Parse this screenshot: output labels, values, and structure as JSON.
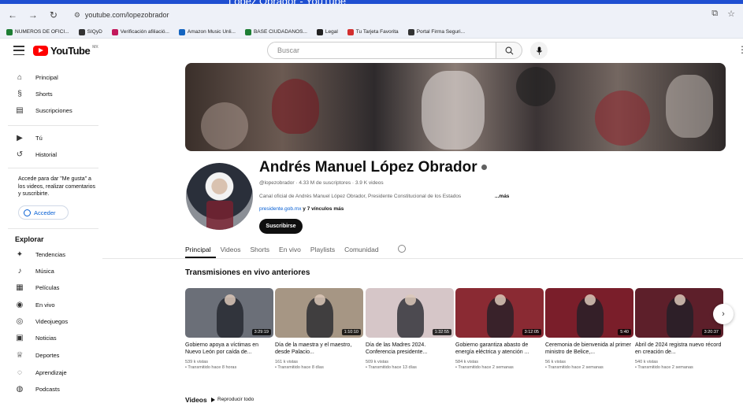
{
  "browser": {
    "tab_title": "López Obrador - YouTube",
    "url": "youtube.com/lopezobrador",
    "bookmarks": [
      {
        "label": "NUMEROS DE OFICI...",
        "color": "#1e7e34"
      },
      {
        "label": "SIQyD",
        "color": "#333333"
      },
      {
        "label": "Verificación afiliació...",
        "color": "#c2185b"
      },
      {
        "label": "Amazon Music Unli...",
        "color": "#1565c0"
      },
      {
        "label": "BASE CIUDADANOS...",
        "color": "#1e7e34"
      },
      {
        "label": "Legal",
        "color": "#222222"
      },
      {
        "label": "Tu Tarjeta Favorita",
        "color": "#d32f2f"
      },
      {
        "label": "Portal Firma Seguri...",
        "color": "#333333"
      }
    ]
  },
  "header": {
    "logo_text": "YouTube",
    "logo_country": "MX",
    "search_placeholder": "Buscar"
  },
  "sidebar": {
    "items_top": [
      {
        "label": "Principal",
        "icon": "home-icon",
        "glyph": "⌂"
      },
      {
        "label": "Shorts",
        "icon": "shorts-icon",
        "glyph": "§"
      },
      {
        "label": "Suscripciones",
        "icon": "subscriptions-icon",
        "glyph": "▤"
      }
    ],
    "items_you": [
      {
        "label": "Tú",
        "icon": "you-icon",
        "glyph": "▶"
      },
      {
        "label": "Historial",
        "icon": "history-icon",
        "glyph": "↺"
      }
    ],
    "signin_text": "Accede para dar \"Me gusta\" a los videos, realizar comentarios y suscribirte.",
    "signin_button": "Acceder",
    "explore_title": "Explorar",
    "explore_items": [
      {
        "label": "Tendencias",
        "icon": "trending-icon",
        "glyph": "✦"
      },
      {
        "label": "Música",
        "icon": "music-icon",
        "glyph": "♪"
      },
      {
        "label": "Películas",
        "icon": "movies-icon",
        "glyph": "▦"
      },
      {
        "label": "En vivo",
        "icon": "live-icon",
        "glyph": "◉"
      },
      {
        "label": "Videojuegos",
        "icon": "gaming-icon",
        "glyph": "◎"
      },
      {
        "label": "Noticias",
        "icon": "news-icon",
        "glyph": "▣"
      },
      {
        "label": "Deportes",
        "icon": "sports-icon",
        "glyph": "♕"
      },
      {
        "label": "Aprendizaje",
        "icon": "learning-icon",
        "glyph": "◌"
      },
      {
        "label": "Podcasts",
        "icon": "podcasts-icon",
        "glyph": "◍"
      }
    ]
  },
  "channel": {
    "name": "Andrés Manuel López Obrador",
    "meta": "@lopezobrador · 4.33 M de suscriptores · 3.9 K videos",
    "description": "Canal oficial de Andrés Manuel López Obrador,  Presidente Constitucional de los Estados",
    "more": "...más",
    "link": "presidente.gob.mx",
    "more_links": "y 7 vínculos más",
    "subscribe": "Suscribirse"
  },
  "tabs": [
    "Principal",
    "Videos",
    "Shorts",
    "En vivo",
    "Playlists",
    "Comunidad"
  ],
  "section_title": "Transmisiones en vivo anteriores",
  "videos": [
    {
      "title": "Gobierno apoya a víctimas en Nuevo León por caída de...",
      "duration": "3:29:19",
      "views": "539 k vistas",
      "time": "• Transmitido hace 8 horas",
      "bg": "#6b6f78"
    },
    {
      "title": "Día de la maestra y el maestro, desde Palacio...",
      "duration": "1:10:10",
      "views": "161 k vistas",
      "time": "• Transmitido hace 8 días",
      "bg": "#a69684"
    },
    {
      "title": "Día de las Madres 2024. Conferencia presidente...",
      "duration": "1:32:55",
      "views": "509 k vistas",
      "time": "• Transmitido hace 13 días",
      "bg": "#d6c6c8"
    },
    {
      "title": "Gobierno garantiza abasto de energía eléctrica y atención ...",
      "duration": "3:12:05",
      "views": "584 k vistas",
      "time": "• Transmitido hace 2 semanas",
      "bg": "#8a2a33"
    },
    {
      "title": "Ceremonia de bienvenida al primer ministro de Belice,...",
      "duration": "5:40",
      "views": "56 k vistas",
      "time": "• Transmitido hace 2 semanas",
      "bg": "#7a1e2a"
    },
    {
      "title": "Abril de 2024 registra nuevo récord en creación de...",
      "duration": "3:20:37",
      "views": "540 k vistas",
      "time": "• Transmitido hace 2 semanas",
      "bg": "#5d1f2a"
    }
  ],
  "videos_section": {
    "title": "Videos",
    "play_all": "Reproducir todo"
  }
}
